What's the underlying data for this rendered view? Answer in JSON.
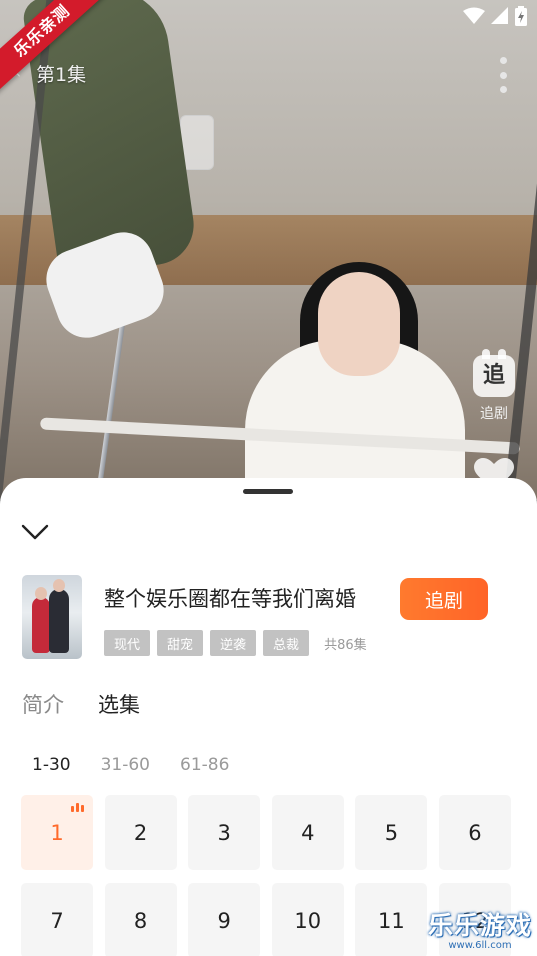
{
  "watermark": {
    "corner": "乐乐亲测",
    "site_name": "乐乐游戏",
    "site_url": "www.6ll.com"
  },
  "player": {
    "episode_title": "第1集",
    "follow_side_label": "追剧",
    "follow_side_icon_text": "追"
  },
  "drama": {
    "title": "整个娱乐圈都在等我们离婚",
    "follow_button": "追剧",
    "tags": [
      "现代",
      "甜宠",
      "逆袭",
      "总裁"
    ],
    "total_episodes": "共86集"
  },
  "section_tabs": [
    {
      "label": "简介",
      "active": false
    },
    {
      "label": "选集",
      "active": true
    }
  ],
  "range_tabs": [
    {
      "label": "1-30",
      "active": true
    },
    {
      "label": "31-60",
      "active": false
    },
    {
      "label": "61-86",
      "active": false
    }
  ],
  "episodes": [
    {
      "label": "1",
      "active": true
    },
    {
      "label": "2"
    },
    {
      "label": "3"
    },
    {
      "label": "4"
    },
    {
      "label": "5"
    },
    {
      "label": "6"
    },
    {
      "label": "7"
    },
    {
      "label": "8"
    },
    {
      "label": "9"
    },
    {
      "label": "10"
    },
    {
      "label": "11"
    },
    {
      "label": "12"
    }
  ],
  "colors": {
    "accent": "#ff6a2b",
    "tag_bg": "#c2c2c2",
    "corner_ribbon": "#d31b2b"
  },
  "icons": [
    "back-arrow-icon",
    "more-vertical-icon",
    "wifi-icon",
    "signal-icon",
    "battery-icon",
    "follow-icon",
    "heart-icon",
    "chevron-down-icon",
    "playing-bars-icon"
  ]
}
